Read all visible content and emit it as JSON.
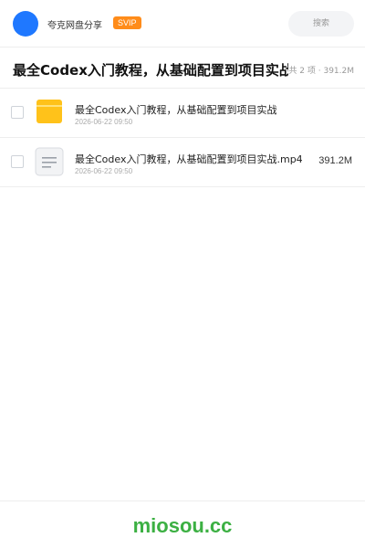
{
  "header": {
    "brand": "夸克网盘分享",
    "badge": "SVIP",
    "search_placeholder": "搜索"
  },
  "folder": {
    "title": "最全Codex入门教程，从基础配置到项目实战",
    "summary": "共 2 项 · 391.2M"
  },
  "files": [
    {
      "name": "最全Codex入门教程，从基础配置到项目实战",
      "date": "2026-06-22 09:50",
      "size": "",
      "icon": "folder-icon"
    },
    {
      "name": "最全Codex入门教程，从基础配置到项目实战.mp4",
      "date": "2026-06-22 09:50",
      "size": "391.2M",
      "icon": "video-file-icon"
    }
  ],
  "footer": {
    "brand": "miosou.cc"
  },
  "colors": {
    "avatar": "#1f78ff",
    "badge": "#ff8c1a",
    "folder": "#ffc21a",
    "footer_brand": "#3cb043"
  }
}
